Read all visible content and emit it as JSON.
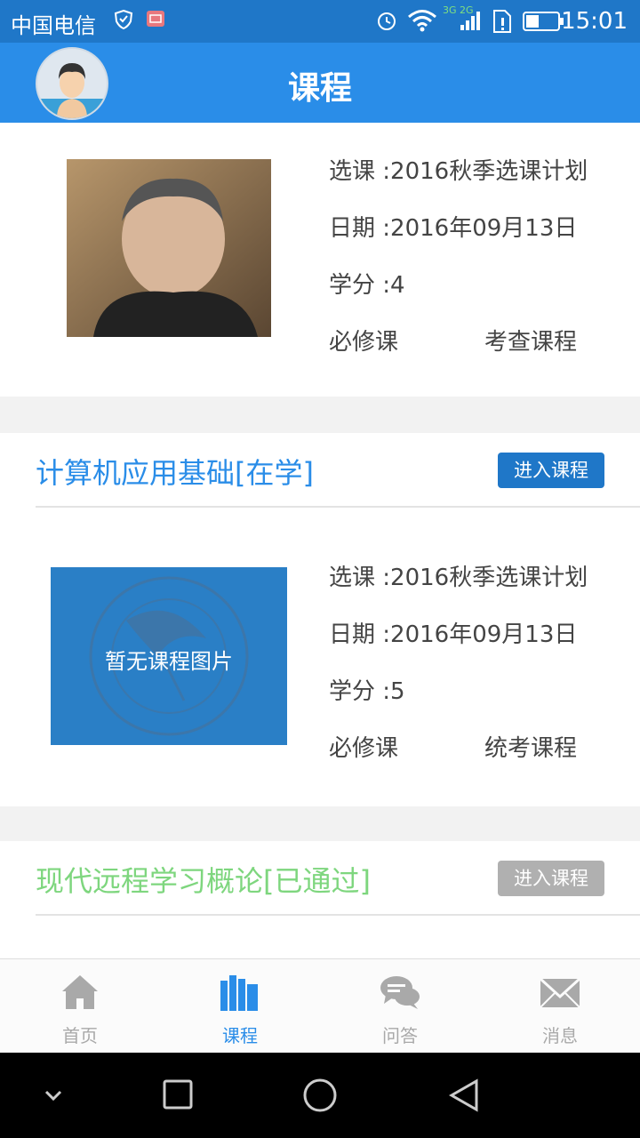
{
  "status_bar": {
    "carrier": "中国电信",
    "network": "3G 2G",
    "time": "15:01"
  },
  "header": {
    "title": "课程"
  },
  "courses": [
    {
      "title": "",
      "selection": "选课 :2016秋季选课计划",
      "date": "日期 :2016年09月13日",
      "credits": "学分 :4",
      "type": "必修课",
      "exam": "考查课程"
    },
    {
      "title": "计算机应用基础[在学]",
      "title_color": "#2a8de8",
      "enter_label": "进入课程",
      "enter_color": "#1f77c8",
      "placeholder": "暂无课程图片",
      "selection": "选课 :2016秋季选课计划",
      "date": "日期 :2016年09月13日",
      "credits": "学分 :5",
      "type": "必修课",
      "exam": "统考课程"
    },
    {
      "title": "现代远程学习概论[已通过]",
      "title_color": "#7ed67e",
      "enter_label": "进入课程",
      "enter_color": "#b0b0b0"
    }
  ],
  "bottom_nav": [
    {
      "label": "首页",
      "icon": "home-icon",
      "active": false
    },
    {
      "label": "课程",
      "icon": "books-icon",
      "active": true
    },
    {
      "label": "问答",
      "icon": "chat-icon",
      "active": false
    },
    {
      "label": "消息",
      "icon": "mail-icon",
      "active": false
    }
  ],
  "colors": {
    "accent": "#2a8de8",
    "inactive": "#a9a9a9"
  }
}
